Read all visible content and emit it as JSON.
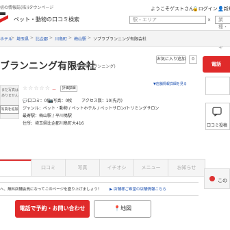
{
  "header": {
    "tagline": "初の情報誌(株)iタウンページ",
    "site_title": "ペット・動物の口コミ検索",
    "welcome": "ようこそゲストさん",
    "login": "ログイン",
    "register": "新規",
    "search_area_placeholder": "駅・エリア",
    "search_keyword_placeholder": "業種・店名・キ"
  },
  "breadcrumb": [
    "ホテル",
    "埼玉県",
    "比企郡",
    "川島町",
    "梅山駅",
    "ソブラブランニング有限会社"
  ],
  "shop": {
    "name": "ブランニング有限会社",
    "kana": "(ソブラブランニング)",
    "favorite_label": "お気に入り追加",
    "favorite_count": "0",
    "stars": "☆☆☆☆☆",
    "rating": "ー",
    "eval_label": "評価詳細",
    "edit_link": "▼店舗情報詳細を見る",
    "reviews": "口コミ：0件",
    "photos": "写真：0枚",
    "access": "アクセス数：10(先月)",
    "genre": "ジャンル：ペット・動物 / ペットホテル / ペットサロン/トリミングサロン",
    "station": "最寄駅：梅山駅 / 平川鳴駅",
    "address": "住所：埼玉県比企郡川島町大416"
  },
  "photo_placeholder": [
    "まだ写真は",
    "ありません",
    "写真を追加する"
  ],
  "sidebar": {
    "cta_label": "電話",
    "review_post": "口コミ投稿"
  },
  "tabs": [
    "",
    "口コミ",
    "写真",
    "イチオシ",
    "メニュー",
    "お知らせ"
  ],
  "notice": {
    "text": "へ、無料店舗会員になってこのページを盛り上げましょう！",
    "link": "▶ 店舗様ご希望の店舗情報こちら"
  },
  "actions": {
    "call": "電話で予約・お問い合わせ",
    "map": "地図"
  },
  "right_panel_title": "この"
}
